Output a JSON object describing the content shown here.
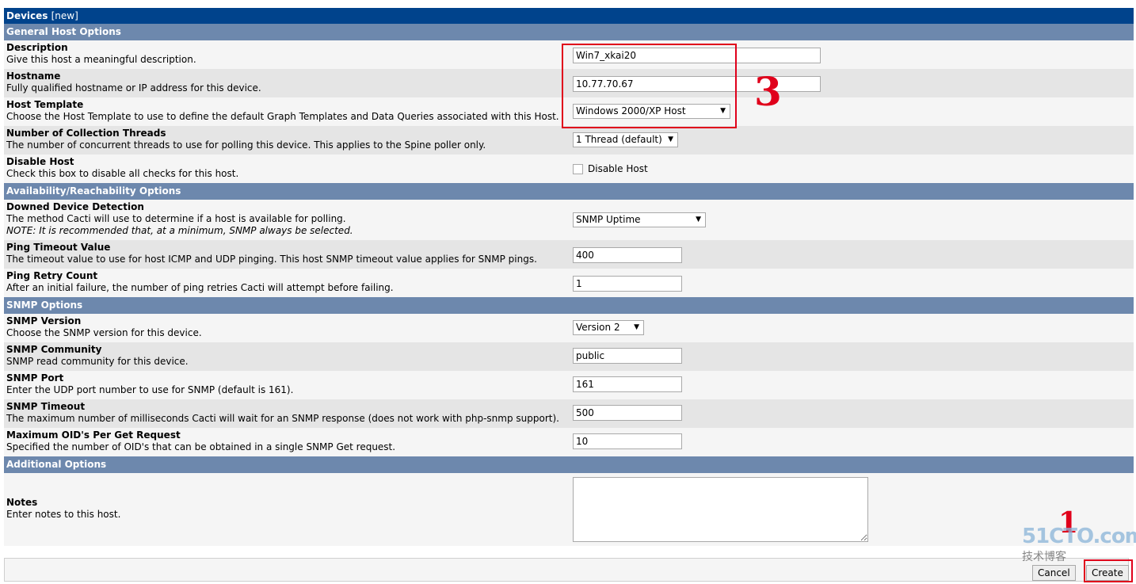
{
  "header": {
    "title": "Devices",
    "suffix": "[new]"
  },
  "sections": {
    "general": "General Host Options",
    "availability": "Availability/Reachability Options",
    "snmp": "SNMP Options",
    "additional": "Additional Options"
  },
  "fields": {
    "description": {
      "title": "Description",
      "desc": "Give this host a meaningful description.",
      "value": "Win7_xkai20"
    },
    "hostname": {
      "title": "Hostname",
      "desc": "Fully qualified hostname or IP address for this device.",
      "value": "10.77.70.67"
    },
    "host_template": {
      "title": "Host Template",
      "desc": "Choose the Host Template to use to define the default Graph Templates and Data Queries associated with this Host.",
      "value": "Windows 2000/XP Host"
    },
    "threads": {
      "title": "Number of Collection Threads",
      "desc": "The number of concurrent threads to use for polling this device. This applies to the Spine poller only.",
      "value": "1 Thread (default)"
    },
    "disable_host": {
      "title": "Disable Host",
      "desc": "Check this box to disable all checks for this host.",
      "checkbox_label": "Disable Host",
      "checked": false
    },
    "downed_detection": {
      "title": "Downed Device Detection",
      "desc": "The method Cacti will use to determine if a host is available for polling.",
      "note": "NOTE: It is recommended that, at a minimum, SNMP always be selected.",
      "value": "SNMP Uptime"
    },
    "ping_timeout": {
      "title": "Ping Timeout Value",
      "desc": "The timeout value to use for host ICMP and UDP pinging. This host SNMP timeout value applies for SNMP pings.",
      "value": "400"
    },
    "ping_retry": {
      "title": "Ping Retry Count",
      "desc": "After an initial failure, the number of ping retries Cacti will attempt before failing.",
      "value": "1"
    },
    "snmp_version": {
      "title": "SNMP Version",
      "desc": "Choose the SNMP version for this device.",
      "value": "Version 2"
    },
    "snmp_community": {
      "title": "SNMP Community",
      "desc": "SNMP read community for this device.",
      "value": "public"
    },
    "snmp_port": {
      "title": "SNMP Port",
      "desc": "Enter the UDP port number to use for SNMP (default is 161).",
      "value": "161"
    },
    "snmp_timeout": {
      "title": "SNMP Timeout",
      "desc": "The maximum number of milliseconds Cacti will wait for an SNMP response (does not work with php-snmp support).",
      "value": "500"
    },
    "max_oids": {
      "title": "Maximum OID's Per Get Request",
      "desc": "Specified the number of OID's that can be obtained in a single SNMP Get request.",
      "value": "10"
    },
    "notes": {
      "title": "Notes",
      "desc": "Enter notes to this host.",
      "value": ""
    }
  },
  "buttons": {
    "cancel": "Cancel",
    "create": "Create"
  },
  "annotations": {
    "step3": "3",
    "step1": "1"
  },
  "watermark": {
    "brand": "51CTO.com",
    "tagline": "技术博客"
  },
  "colors": {
    "title_bar": "#00438c",
    "section_bar": "#6d88ad",
    "annotation_red": "#e0001b"
  }
}
